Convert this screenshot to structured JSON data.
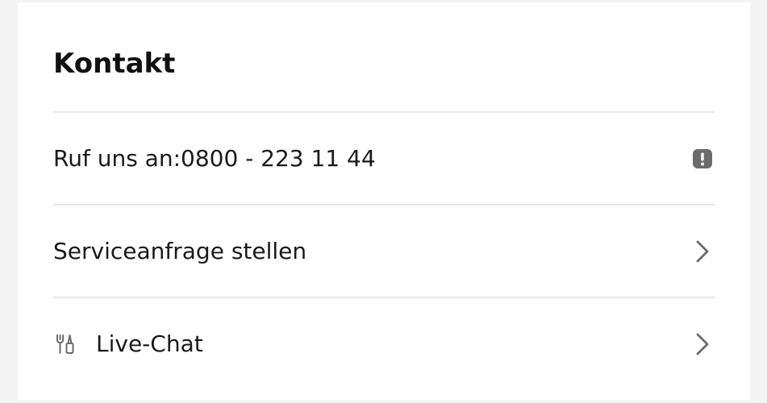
{
  "contact": {
    "title": "Kontakt",
    "rows": [
      {
        "label": "Ruf uns an:0800 - 223 11 44",
        "trailing_icon": "info-badge-icon"
      },
      {
        "label": "Serviceanfrage stellen",
        "trailing_icon": "chevron-right-icon"
      },
      {
        "label": "Live-Chat",
        "leading_icon": "tools-icon",
        "trailing_icon": "chevron-right-icon"
      }
    ]
  },
  "colors": {
    "background": "#f3f3f3",
    "card": "#ffffff",
    "divider": "#e8e8e8",
    "text": "#1a1a1a",
    "icon": "#6b6b6b"
  }
}
